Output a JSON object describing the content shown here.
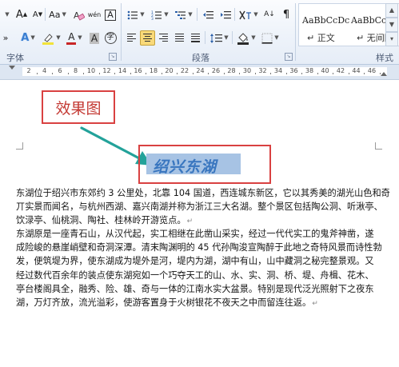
{
  "ribbon": {
    "font": {
      "grow_label": "A",
      "shrink_label": "A",
      "change_case_label": "Aa",
      "clear_format_label": "A",
      "pinyin_label": "wén",
      "border_char_label": "A",
      "text_effect_label": "A",
      "font_color_label": "A",
      "char_shade_label": "A",
      "enclose_char_label": "字",
      "group_label": "字体"
    },
    "paragraph": {
      "group_label": "段落",
      "sort_label": "A↓"
    },
    "styles": {
      "group_label": "样式",
      "items": [
        {
          "sample": "AaBbCcDc",
          "name": "↵ 正文"
        },
        {
          "sample": "AaBbCcDc",
          "name": "↵ 无间隔"
        }
      ]
    },
    "colors": {
      "highlight": "#f2e33a",
      "font_color": "#c82626",
      "selection": "#a7c3e4",
      "callout": "#d94141",
      "arrow": "#23a29a"
    }
  },
  "ruler": {
    "numbers": [
      "2",
      "4",
      "6",
      "8",
      "10",
      "12",
      "14",
      "16",
      "18",
      "20",
      "22",
      "24",
      "26",
      "28",
      "30",
      "32",
      "34",
      "36",
      "38",
      "40",
      "42",
      "44",
      "46"
    ]
  },
  "document": {
    "callout_label": "效果图",
    "title": "绍兴东湖",
    "paragraph_mark": "↵",
    "lines": [
      "东湖位于绍兴市东郊约 3 公里处，北靠 104 国道，西连城东新区，它以其秀美的湖光山色和奇",
      "丌实景而闻名，与杭州西湖、嘉兴南湖并称为浙江三大名湖。整个景区包括陶公洞、听湫亭、",
      "饮渌亭、仙桃洞、陶社、桂林岭开游览点。",
      "东湖原是一座青石山，从汉代起，实工相继在此凿山采实，经过一代代实工的鬼斧神凿，遂",
      "成险峻的悬崖峭壁和奇洞深潭。清末陶渊明的 45 代孙陶浚宣陶醉于此地之奇特风景而诗性勃",
      "发，便筑堤为界，使东湖成为堤外是河，堤内为湖，湖中有山，山中藏洞之秘完整景观。又",
      "经过数代百余年的装点使东湖宛如一个巧夺天工的山、水、实、洞、桥、堤、舟楫、花木、",
      "亭台楼阁具全，融秀、险、雄、奇与一体的江南水实大盆景。特别是现代泛光照射下之夜东",
      "湖，万灯齐放，流光溢彩，使游客置身于火树银花不夜天之中而留连往返。"
    ]
  }
}
